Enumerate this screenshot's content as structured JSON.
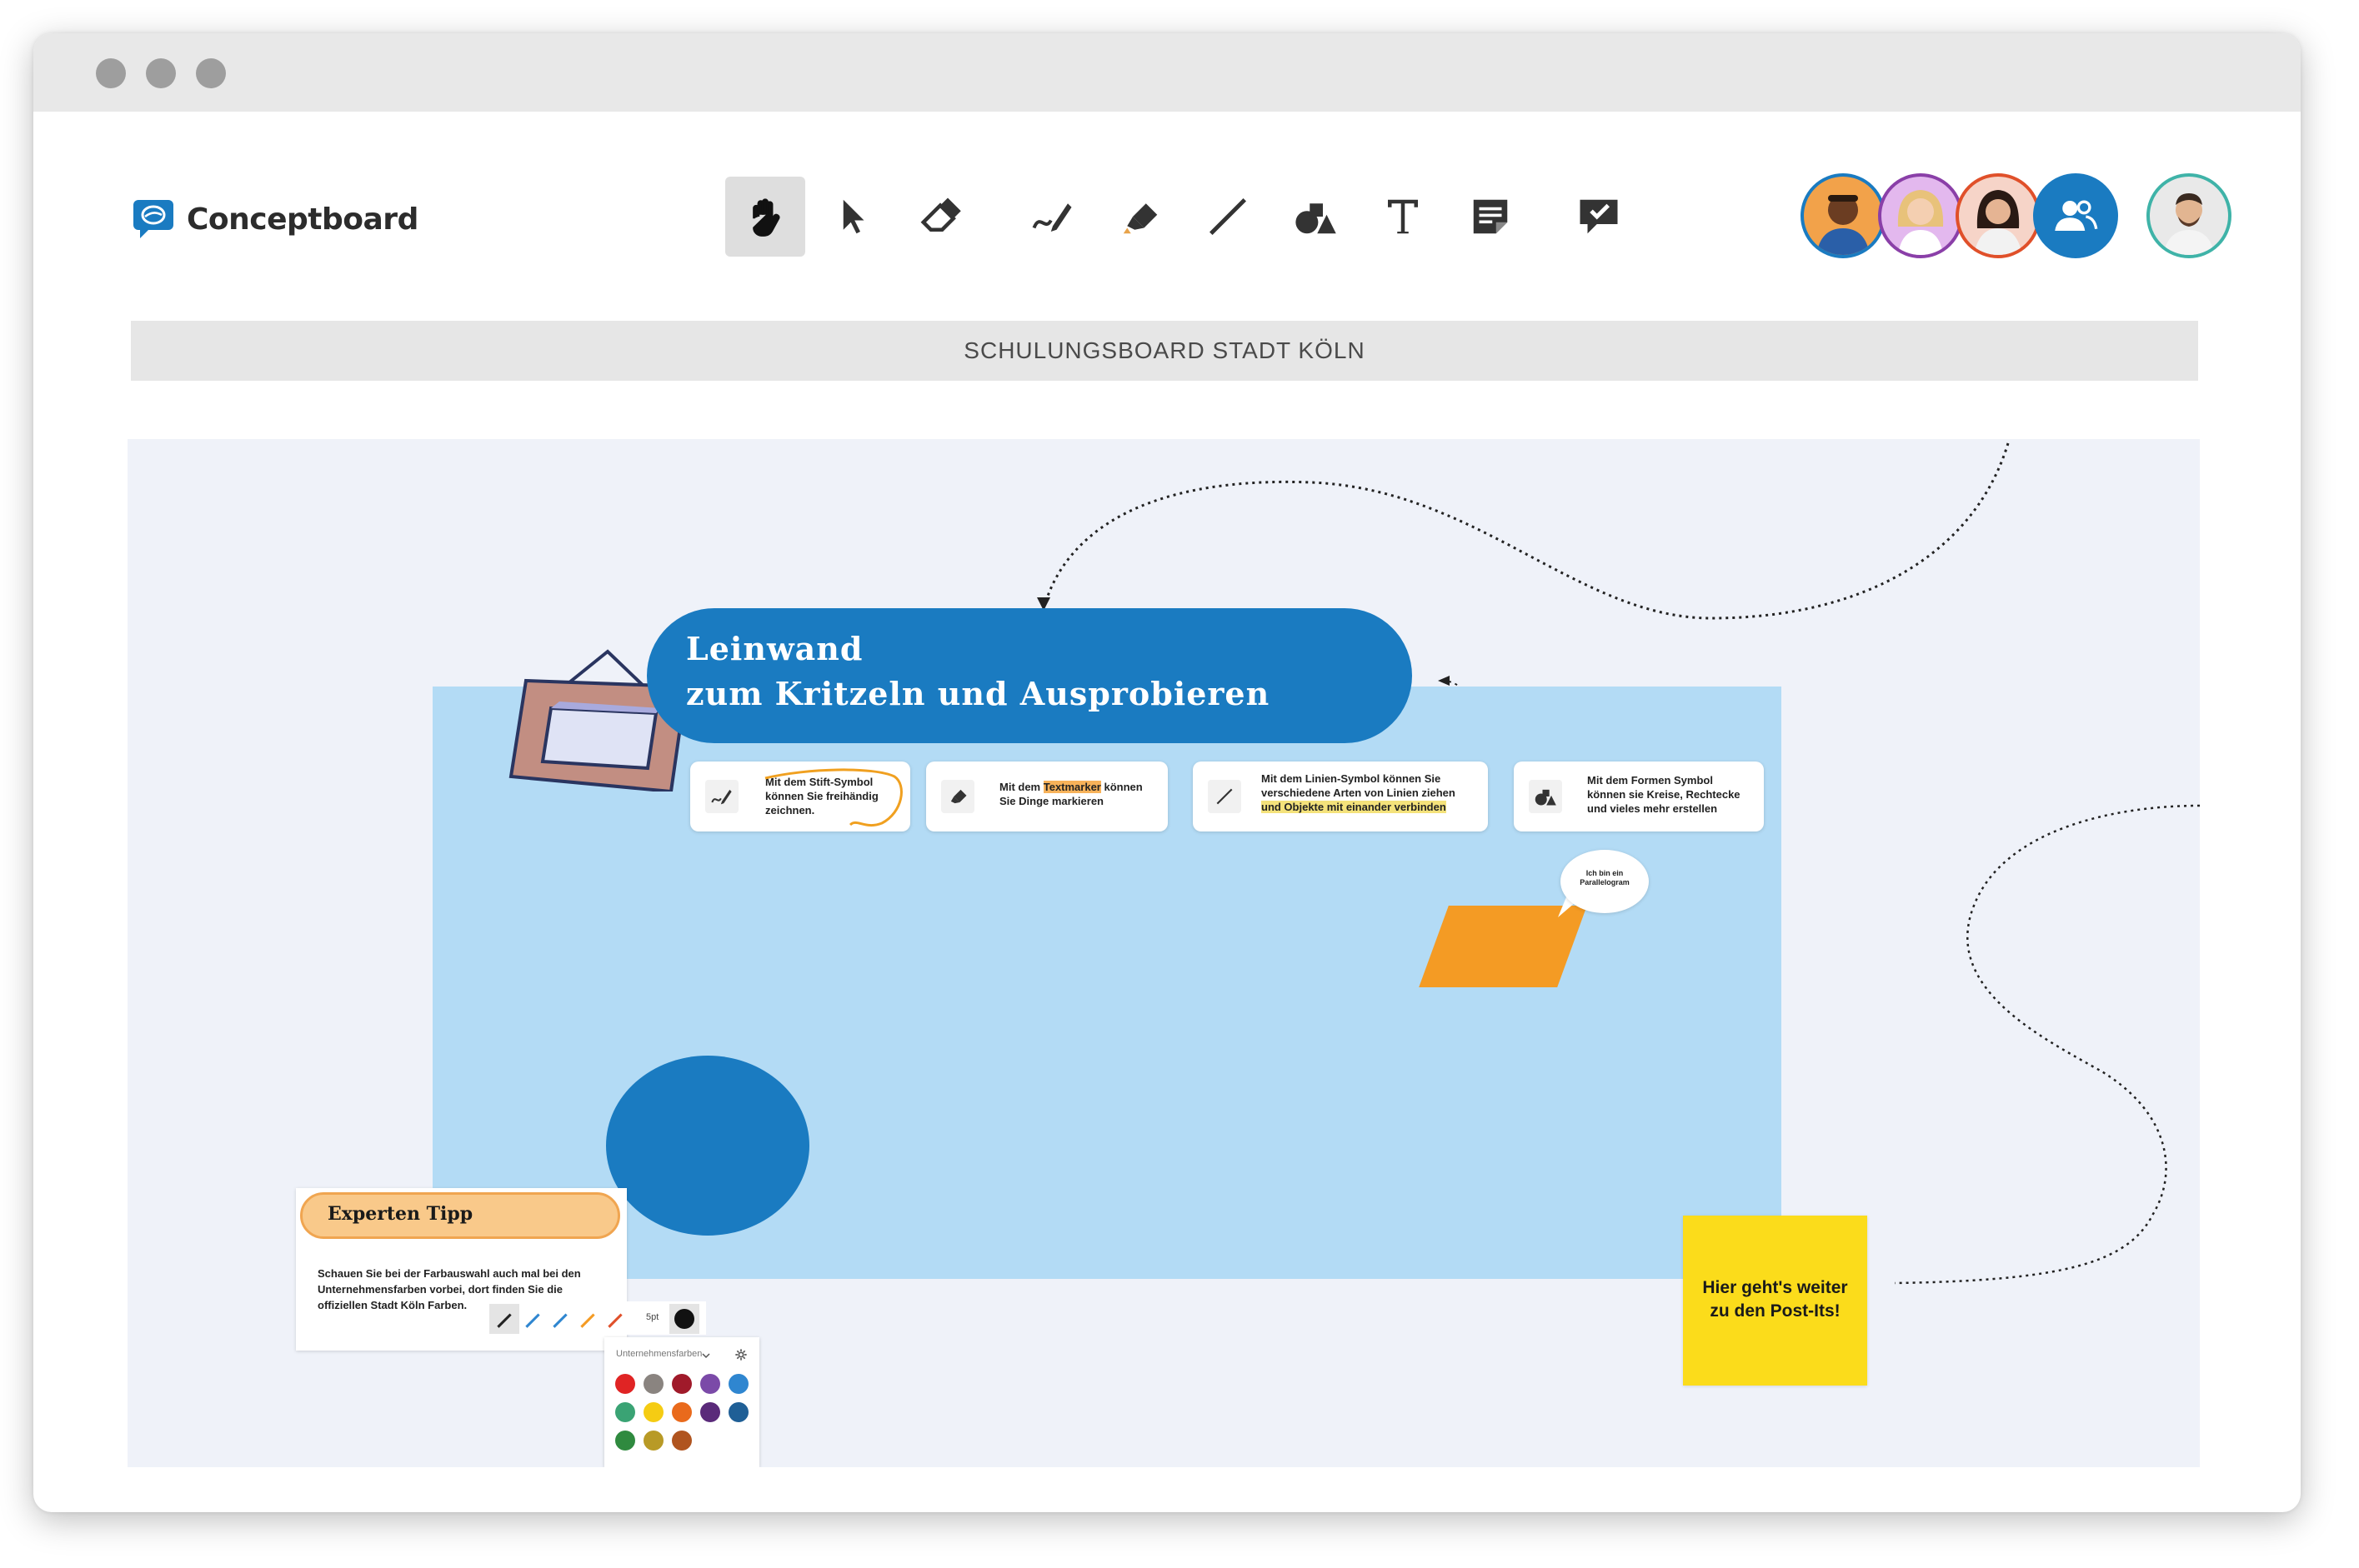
{
  "app": {
    "name": "Conceptboard"
  },
  "toolbar": {
    "tools": [
      {
        "icon": "hand-icon",
        "active": true
      },
      {
        "icon": "select-arrow-icon"
      },
      {
        "icon": "eraser-icon"
      },
      {
        "icon": "pen-icon"
      },
      {
        "icon": "highlighter-icon"
      },
      {
        "icon": "line-icon"
      },
      {
        "icon": "shapes-icon"
      },
      {
        "icon": "text-icon"
      },
      {
        "icon": "sticky-note-icon"
      },
      {
        "icon": "comment-check-icon"
      }
    ]
  },
  "collaborators": [
    {
      "name": "collaborator-1",
      "ring": "#1a7bc1"
    },
    {
      "name": "collaborator-2",
      "ring": "#8a3fa8"
    },
    {
      "name": "collaborator-3",
      "ring": "#e0502a"
    },
    {
      "name": "share-users",
      "ring": "#1a7bc1"
    },
    {
      "name": "current-user",
      "ring": "#3fb3a8"
    }
  ],
  "board": {
    "title": "SCHULUNGSBOARD STADT KÖLN"
  },
  "canvas": {
    "header": {
      "line1": "Leinwand",
      "line2": "zum Kritzeln und Ausprobieren"
    },
    "cards": [
      {
        "icon": "pen-icon",
        "line1": "Mit dem Stift-Symbol",
        "line2": "können Sie freihändig",
        "line3": "zeichnen."
      },
      {
        "icon": "highlighter-icon",
        "pre": "Mit dem ",
        "highlight": "Textmarker",
        "post": " können",
        "line2": "Sie Dinge markieren"
      },
      {
        "icon": "line-icon",
        "line1": "Mit dem Linien-Symbol können Sie",
        "line2": "verschiedene Arten von Linien ziehen",
        "highlight": "und Objekte mit einander verbinden"
      },
      {
        "icon": "shapes-icon",
        "line1": "Mit dem Formen Symbol",
        "line2": "können sie Kreise, Rechtecke",
        "line3": "und vieles mehr erstellen"
      }
    ],
    "bubble": {
      "line1": "Ich bin ein",
      "line2": "Parallelogram"
    },
    "tip": {
      "title": "Experten Tipp",
      "line1": "Schauen Sie bei der Farbauswahl auch mal bei den",
      "line2": "Unternehmensfarben vorbei, dort finden Sie die",
      "line3": "offiziellen Stadt Köln Farben.",
      "pen_size": "5pt"
    },
    "palette": {
      "label": "Unternehmensfarben",
      "colors": [
        "#e02424",
        "#8a8480",
        "#a01a2a",
        "#7b4aa8",
        "#2f86d0",
        "#3aa374",
        "#f5cc13",
        "#e96a1c",
        "#5a2a7a",
        "#1f5f96",
        "#2f8a3f",
        "#b89a26",
        "#b0541f"
      ]
    },
    "sticky": {
      "line1": "Hier geht's weiter",
      "line2": "zu den Post-Its!"
    }
  },
  "colors": {
    "brand_blue": "#1a7bc1",
    "canvas_bg": "#eff2f9",
    "light_blue": "#b3dbf5",
    "orange": "#f49b24",
    "sticky_yellow": "#fbdc1b"
  }
}
